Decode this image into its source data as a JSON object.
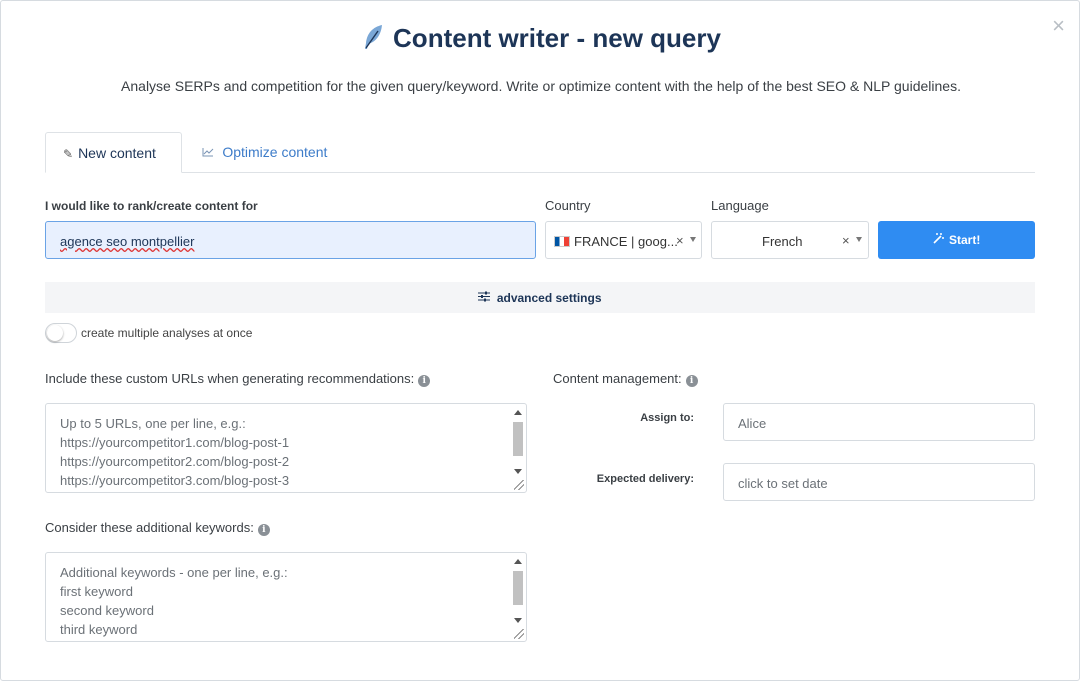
{
  "header": {
    "title": "Content writer - new query",
    "subtitle": "Analyse SERPs and competition for the given query/keyword. Write or optimize content with the help of the best SEO & NLP guidelines.",
    "close_label": "×"
  },
  "tabs": [
    {
      "label": "New content",
      "icon": "pencil-icon",
      "active": true
    },
    {
      "label": "Optimize content",
      "icon": "chart-line-icon",
      "active": false
    }
  ],
  "form": {
    "query_label": "I would like to rank/create content for",
    "query_value": "agence seo montpellier",
    "country_label": "Country",
    "country_value": "FRANCE | goog...",
    "language_label": "Language",
    "language_value": "French",
    "clear_symbol": "×",
    "start_label": "Start!",
    "advanced_label": "advanced settings",
    "multi_label": "create multiple analyses at once"
  },
  "custom_urls": {
    "label": "Include these custom URLs when generating recommendations:",
    "placeholder_lines": [
      "Up to 5 URLs, one per line, e.g.:",
      "https://yourcompetitor1.com/blog-post-1",
      "https://yourcompetitor2.com/blog-post-2",
      "https://yourcompetitor3.com/blog-post-3"
    ]
  },
  "keywords": {
    "label": "Consider these additional keywords:",
    "placeholder_lines": [
      "Additional keywords - one per line, e.g.:",
      "first keyword",
      "second keyword",
      "third keyword"
    ]
  },
  "management": {
    "label": "Content management:",
    "assign_label": "Assign to:",
    "assign_value": "Alice",
    "delivery_label": "Expected delivery:",
    "delivery_placeholder": "click to set date"
  },
  "colors": {
    "title": "#1d3557",
    "primary_button": "#2f8cf2",
    "tab_link": "#3d7cc9",
    "input_focus_bg": "#e8f0fe"
  }
}
